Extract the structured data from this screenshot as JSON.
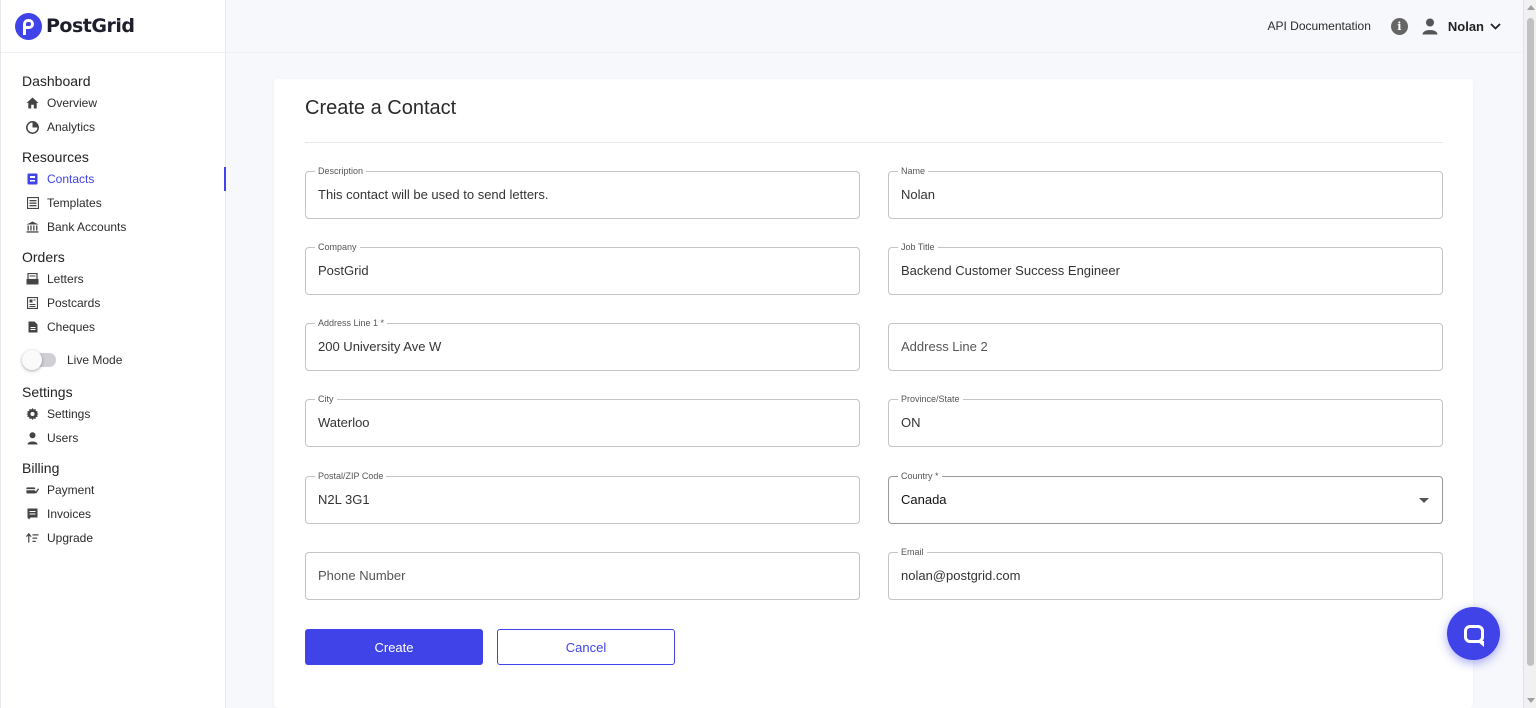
{
  "app": {
    "logo_text": "PostGrid",
    "accent": "#3f43e8"
  },
  "sidebar": {
    "sections": [
      {
        "title": "Dashboard",
        "items": [
          {
            "label": "Overview",
            "icon": "home-icon"
          },
          {
            "label": "Analytics",
            "icon": "pie-chart-icon"
          }
        ]
      },
      {
        "title": "Resources",
        "items": [
          {
            "label": "Contacts",
            "icon": "contact-card-icon",
            "active": true
          },
          {
            "label": "Templates",
            "icon": "template-icon"
          },
          {
            "label": "Bank Accounts",
            "icon": "bank-icon"
          }
        ]
      },
      {
        "title": "Orders",
        "items": [
          {
            "label": "Letters",
            "icon": "letter-icon"
          },
          {
            "label": "Postcards",
            "icon": "postcard-icon"
          },
          {
            "label": "Cheques",
            "icon": "cheque-icon"
          }
        ]
      },
      {
        "title": "Settings",
        "items": [
          {
            "label": "Settings",
            "icon": "gear-icon"
          },
          {
            "label": "Users",
            "icon": "user-icon"
          }
        ]
      },
      {
        "title": "Billing",
        "items": [
          {
            "label": "Payment",
            "icon": "payment-icon"
          },
          {
            "label": "Invoices",
            "icon": "invoice-icon"
          },
          {
            "label": "Upgrade",
            "icon": "upgrade-icon"
          }
        ]
      }
    ],
    "live_mode": {
      "label": "Live Mode",
      "on": false
    }
  },
  "topbar": {
    "api_docs": "API Documentation",
    "user_name": "Nolan"
  },
  "form": {
    "title": "Create a Contact",
    "fields": {
      "description": {
        "label": "Description",
        "value": "This contact will be used to send letters."
      },
      "name": {
        "label": "Name",
        "value": "Nolan"
      },
      "company": {
        "label": "Company",
        "value": "PostGrid"
      },
      "job_title": {
        "label": "Job Title",
        "value": "Backend Customer Success Engineer"
      },
      "address1": {
        "label": "Address Line 1 *",
        "value": "200 University Ave W"
      },
      "address2": {
        "placeholder": "Address Line 2"
      },
      "city": {
        "label": "City",
        "value": "Waterloo"
      },
      "province": {
        "label": "Province/State",
        "value": "ON"
      },
      "postal": {
        "label": "Postal/ZIP Code",
        "value": "N2L 3G1"
      },
      "country": {
        "label": "Country *",
        "value": "Canada"
      },
      "phone": {
        "placeholder": "Phone Number"
      },
      "email": {
        "label": "Email",
        "value": "nolan@postgrid.com"
      }
    },
    "create_label": "Create",
    "cancel_label": "Cancel"
  }
}
